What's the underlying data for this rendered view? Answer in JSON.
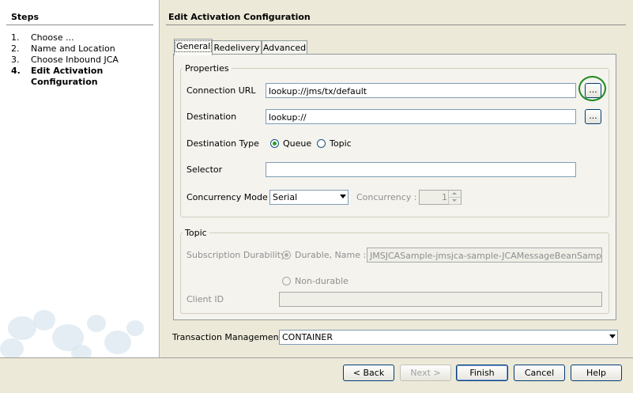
{
  "steps": {
    "title": "Steps",
    "items": [
      {
        "num": "1.",
        "label": "Choose ..."
      },
      {
        "num": "2.",
        "label": "Name and Location"
      },
      {
        "num": "3.",
        "label": "Choose Inbound JCA"
      },
      {
        "num": "4.",
        "label": "Edit Activation",
        "label2": "Configuration",
        "current": true
      }
    ]
  },
  "main": {
    "title": "Edit Activation Configuration",
    "tabs": [
      {
        "label": "General",
        "selected": true
      },
      {
        "label": "Redelivery"
      },
      {
        "label": "Advanced"
      }
    ],
    "properties": {
      "group_label": "Properties",
      "connection_url_label": "Connection URL",
      "connection_url_value": "lookup://jms/tx/default",
      "destination_label": "Destination",
      "destination_value": "lookup://",
      "destination_type_label": "Destination Type",
      "queue_label": "Queue",
      "topic_label": "Topic",
      "selector_label": "Selector",
      "selector_value": "",
      "concurrency_mode_label": "Concurrency Mode",
      "concurrency_mode_value": "Serial",
      "concurrency_label": "Concurrency :",
      "concurrency_value": "1",
      "browse_label": "..."
    },
    "topic": {
      "group_label": "Topic",
      "durability_label": "Subscription Durability",
      "durable_label": "Durable, Name :",
      "durable_name_value": "JMSJCASample-jmsjca-sample-JCAMessageBeanSample-Sub",
      "nondurable_label": "Non-durable",
      "client_id_label": "Client ID",
      "client_id_value": ""
    },
    "transaction_label": "Transaction Management:",
    "transaction_value": "CONTAINER"
  },
  "footer": {
    "back": "< Back",
    "next": "Next >",
    "finish": "Finish",
    "cancel": "Cancel",
    "help": "Help"
  },
  "colors": {
    "highlight": "#1f8a1f",
    "radio_selected": "#21a121"
  }
}
